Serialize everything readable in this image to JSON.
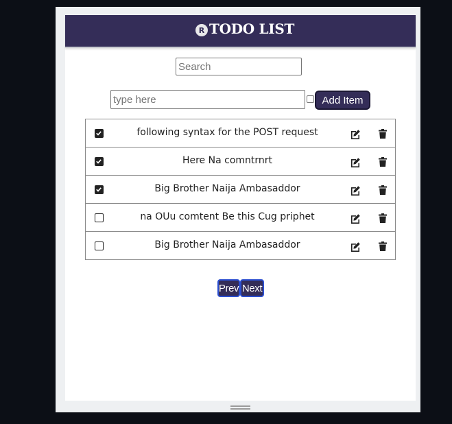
{
  "header": {
    "badge": "R",
    "title": "TODO LIST"
  },
  "search": {
    "placeholder": "Search",
    "value": ""
  },
  "new_item": {
    "placeholder": "type here",
    "value": "",
    "add_label": "Add Item"
  },
  "todos": [
    {
      "text": "following syntax for the POST request",
      "checked": true
    },
    {
      "text": "Here Na comntrnrt",
      "checked": true
    },
    {
      "text": "Big Brother Naija Ambasaddor",
      "checked": true
    },
    {
      "text": "na OUu comtent Be this Cug priphet",
      "checked": false
    },
    {
      "text": "Big Brother Naija Ambasaddor",
      "checked": false
    }
  ],
  "pagination": {
    "prev_label": "Prev",
    "next_label": "Next"
  },
  "icons": {
    "edit": "edit-icon",
    "delete": "trash-icon",
    "resize": "resize-handle-icon"
  },
  "colors": {
    "accent": "#342d58",
    "page_bg": "#0c0f16"
  }
}
